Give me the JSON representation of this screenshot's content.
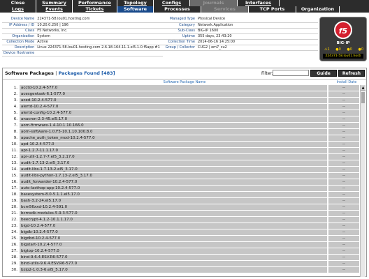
{
  "nav": {
    "row1": [
      {
        "label": "Close",
        "underline": false,
        "state": "normal"
      },
      {
        "label": "Summary",
        "underline": true,
        "state": "normal"
      },
      {
        "label": "Performance",
        "underline": true,
        "state": "normal"
      },
      {
        "label": "Topology",
        "underline": true,
        "state": "normal"
      },
      {
        "label": "Configs",
        "underline": true,
        "state": "normal"
      },
      {
        "label": "Journals",
        "underline": false,
        "state": "disabled"
      },
      {
        "label": "Interfaces",
        "underline": true,
        "state": "normal"
      }
    ],
    "row2": [
      {
        "label": "Logs",
        "underline": true,
        "state": "normal"
      },
      {
        "label": "Events",
        "underline": true,
        "state": "normal"
      },
      {
        "label": "Tickets",
        "underline": true,
        "state": "normal"
      },
      {
        "label": "Software",
        "underline": false,
        "state": "active"
      },
      {
        "label": "Processes",
        "underline": false,
        "state": "normal"
      },
      {
        "label": "Services",
        "underline": false,
        "state": "disabled"
      },
      {
        "label": "TCP Ports",
        "underline": false,
        "state": "normal"
      },
      {
        "label": "Organization",
        "underline": false,
        "state": "normal"
      }
    ]
  },
  "device": {
    "left": [
      {
        "key": "Device Name",
        "value": "224371-58.lou01.hosting.com"
      },
      {
        "key": "IP Address / ID",
        "value": "10.20.0.250 | 196"
      },
      {
        "key": "Class",
        "value": "F5 Networks, Inc."
      },
      {
        "key": "Organization",
        "value": "System"
      },
      {
        "key": "Collection Mode",
        "value": "Active"
      },
      {
        "key": "Description",
        "value": "Linux 224371-58.lou01.hosting.com 2.6.18-164.11.1.el5.1.0.f5app #1"
      },
      {
        "key": "Device Hostname",
        "value": ""
      }
    ],
    "right": [
      {
        "key": "Managed Type",
        "value": "Physical Device"
      },
      {
        "key": "Category",
        "value": "Network.Application"
      },
      {
        "key": "Sub-Class",
        "value": "BIG-IP 1600"
      },
      {
        "key": "Uptime",
        "value": "355 days, 23:43:20"
      },
      {
        "key": "Collection Time",
        "value": "2014-06-16 14:25:00"
      },
      {
        "key": "Group / Collector",
        "value": "CUG2 | em7_cu2"
      }
    ],
    "image": {
      "logo_text": "f5",
      "model": "BIG-IP",
      "host_label": "224371-58.lou01.hosti",
      "alert_counts": [
        "1",
        "0",
        "0",
        "0"
      ]
    }
  },
  "packages": {
    "title": "Software Packages",
    "separator": "|",
    "found_label": "Packages Found [483]",
    "filter_label": "Filter:",
    "filter_value": "",
    "guide_button": "Guide",
    "refresh_button": "Refresh",
    "col_name": "Software Package Name",
    "col_date": "Install Date",
    "scroll_up_glyph": "▲",
    "rows": [
      {
        "num": "1.",
        "name": "acctd-10.2.4-577.0",
        "date": "--"
      },
      {
        "num": "2.",
        "name": "acesgentask-6.1-577.0",
        "date": "--"
      },
      {
        "num": "3.",
        "name": "aced-10.2.4-577.0",
        "date": "--"
      },
      {
        "num": "4.",
        "name": "alertd-10.2.4-577.0",
        "date": "--"
      },
      {
        "num": "5.",
        "name": "alertd-config-10.2.4-577.0",
        "date": "--"
      },
      {
        "num": "6.",
        "name": "anacron-2.3-45.el5.17.0",
        "date": "--"
      },
      {
        "num": "7.",
        "name": "aom-firmware-1.4-10.1.10.166.0",
        "date": "--"
      },
      {
        "num": "8.",
        "name": "aom-software-1.0.F5-10.1.10.100.8.0",
        "date": "--"
      },
      {
        "num": "9.",
        "name": "apache_auth_token_mod-10.2.4-577.0",
        "date": "--"
      },
      {
        "num": "10.",
        "name": "apd-10.2.4-577.0",
        "date": "--"
      },
      {
        "num": "11.",
        "name": "apr-1.2.7-11.1.17.0",
        "date": "--"
      },
      {
        "num": "12.",
        "name": "apr-util-1.2.7-7.el5_3.2.17.0",
        "date": "--"
      },
      {
        "num": "13.",
        "name": "audit-1.7.13-2.el5_3.17.0",
        "date": "--"
      },
      {
        "num": "14.",
        "name": "audit-libs-1.7.13-2.el5_3.17.0",
        "date": "--"
      },
      {
        "num": "15.",
        "name": "audit-libs-python-1.7.13-2.el5_3.17.0",
        "date": "--"
      },
      {
        "num": "16.",
        "name": "audit_forwarder-10.2.4-577.0",
        "date": "--"
      },
      {
        "num": "17.",
        "name": "auto-lasthop-app-10.2.4-577.0",
        "date": "--"
      },
      {
        "num": "18.",
        "name": "basesystem-8.0-5.1.1.el5.17.0",
        "date": "--"
      },
      {
        "num": "19.",
        "name": "bash-3.2-24.el5.17.0",
        "date": "--"
      },
      {
        "num": "20.",
        "name": "bcm56xxd-10.2.4-591.0",
        "date": "--"
      },
      {
        "num": "21.",
        "name": "bcmsdk-modules-5.9.3-577.0",
        "date": "--"
      },
      {
        "num": "22.",
        "name": "beecrypt-4.1.2-10.1.1.17.0",
        "date": "--"
      },
      {
        "num": "23.",
        "name": "bigd-10.2.4-577.0",
        "date": "--"
      },
      {
        "num": "24.",
        "name": "bigdb-10.2.4-577.0",
        "date": "--"
      },
      {
        "num": "25.",
        "name": "bigdbd-10.2.4-577.0",
        "date": "--"
      },
      {
        "num": "26.",
        "name": "bigstart-10.2.4-577.0",
        "date": "--"
      },
      {
        "num": "27.",
        "name": "bigtop-10.2.4-577.0",
        "date": "--"
      },
      {
        "num": "28.",
        "name": "bind-9.6.4.ESV.R6-577.0",
        "date": "--"
      },
      {
        "num": "29.",
        "name": "bind-utils-9.6.4.ESV.R6-577.0",
        "date": "--"
      },
      {
        "num": "30.",
        "name": "bzip2-1.0.3-6.el5_5.17.0",
        "date": "--"
      }
    ]
  }
}
